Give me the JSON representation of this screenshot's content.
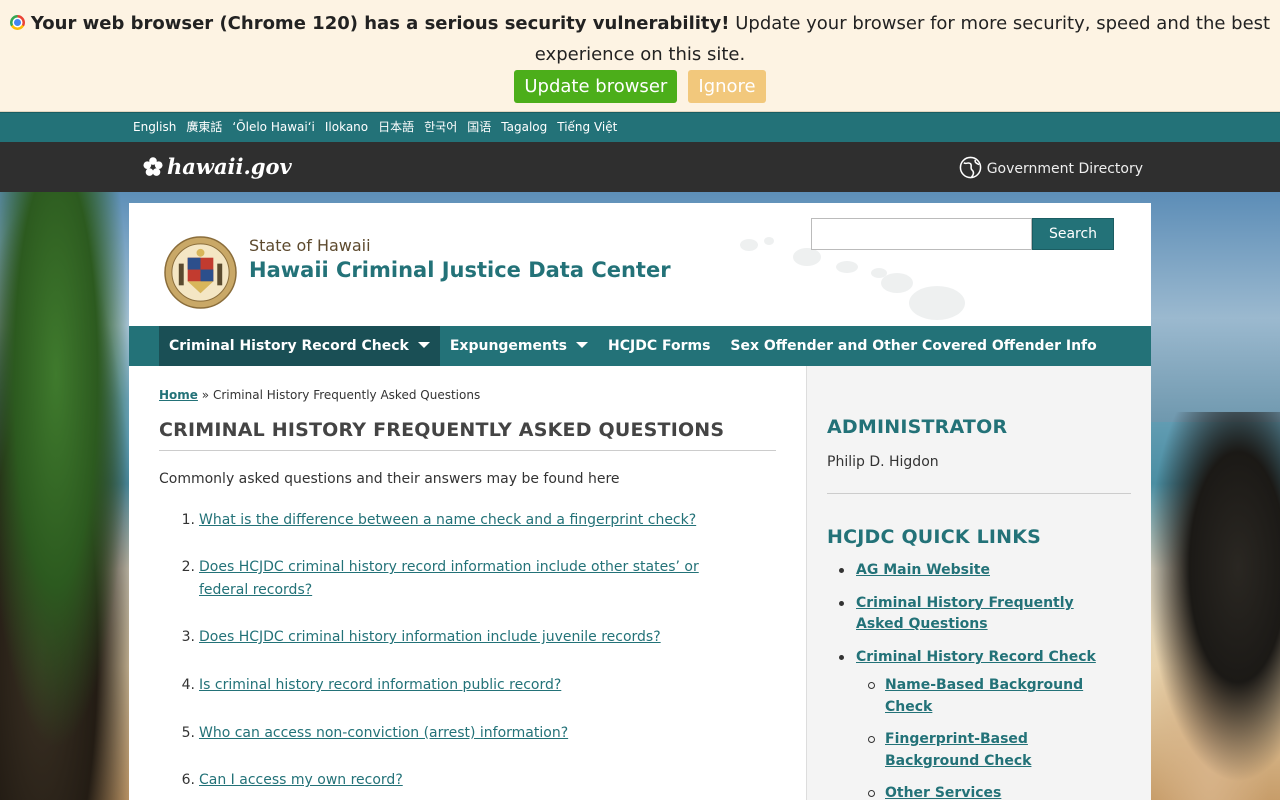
{
  "banner": {
    "bold_text": "Your web browser (Chrome 120) has a serious security vulnerability!",
    "text": "Update your browser for more security, speed and the best experience on this site.",
    "update_label": "Update browser",
    "ignore_label": "Ignore",
    "update_color": "#4cae1a",
    "ignore_color": "#f2c87c"
  },
  "languages": [
    "English",
    "廣東話",
    "ʻŌlelo Hawaiʻi",
    "Ilokano",
    "日本語",
    "한국어",
    "国语",
    "Tagalog",
    "Tiếng Việt"
  ],
  "gov_bar": {
    "logo_text": "hawaii.gov",
    "directory_label": "Government Directory"
  },
  "header": {
    "state_label": "State of Hawaii",
    "agency_name": "Hawaii Criminal Justice Data Center",
    "search_placeholder": "",
    "search_label": "Search"
  },
  "nav": {
    "items": [
      {
        "label": "Criminal History Record Check",
        "has_dropdown": true,
        "active": true
      },
      {
        "label": "Expungements",
        "has_dropdown": true,
        "active": false
      },
      {
        "label": "HCJDC Forms",
        "has_dropdown": false,
        "active": false
      },
      {
        "label": "Sex Offender and Other Covered Offender Info",
        "has_dropdown": false,
        "active": false
      }
    ]
  },
  "breadcrumb": {
    "home": "Home",
    "separator": "»",
    "current": "Criminal History Frequently Asked Questions"
  },
  "main": {
    "title": "CRIMINAL HISTORY FREQUENTLY ASKED QUESTIONS",
    "intro": "Commonly asked questions and their answers may be found here",
    "faq": [
      {
        "num": "1.",
        "text": "What is the difference between a name check and a fingerprint check?"
      },
      {
        "num": "2.",
        "text": "Does HCJDC criminal history record information include other states’ or federal records?"
      },
      {
        "num": "3.",
        "text": "Does HCJDC criminal history information include juvenile records?"
      },
      {
        "num": "4.",
        "text": "Is criminal history record information public record?"
      },
      {
        "num": "5.",
        "text": "Who can access non-conviction (arrest) information?"
      },
      {
        "num": "6.",
        "text": "Can I access my own record?"
      }
    ]
  },
  "sidebar": {
    "admin_heading": "ADMINISTRATOR",
    "admin_name": "Philip D. Higdon",
    "links_heading": "HCJDC QUICK LINKS",
    "links": [
      {
        "label": "AG Main Website"
      },
      {
        "label": "Criminal History Frequently Asked Questions"
      },
      {
        "label": "Criminal History Record Check",
        "children": [
          {
            "label": "Name-Based Background Check"
          },
          {
            "label": "Fingerprint-Based Background Check"
          },
          {
            "label": "Other Services"
          }
        ]
      }
    ]
  },
  "colors": {
    "brand_teal": "#237278",
    "dark_bar": "#2f2f2f",
    "banner_bg": "#fdf3e3"
  }
}
